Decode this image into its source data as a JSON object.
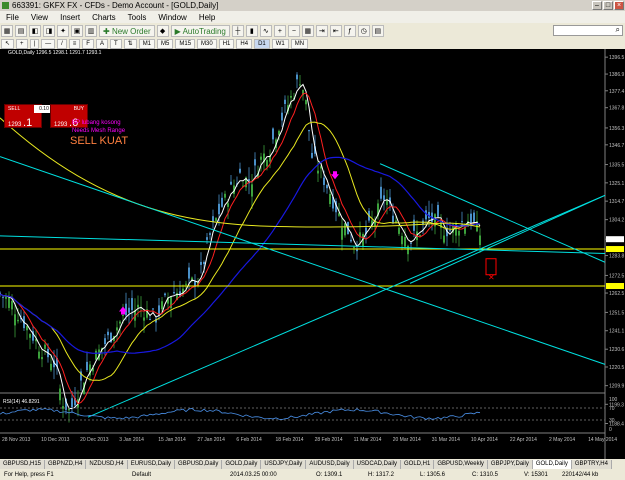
{
  "window": {
    "title": "663391: GKFX FX - CFDs - Demo Account - [GOLD,Daily]",
    "controls": [
      "–",
      "□",
      "×"
    ]
  },
  "menu": [
    "File",
    "View",
    "Insert",
    "Charts",
    "Tools",
    "Window",
    "Help"
  ],
  "toolbar": {
    "new_order": "New Order",
    "autotrading": "AutoTrading",
    "search_placeholder": ""
  },
  "timeframes": [
    "M1",
    "M5",
    "M15",
    "M30",
    "H1",
    "H4",
    "D1",
    "W1",
    "MN"
  ],
  "trade_panel": {
    "sell_label": "SELL",
    "buy_label": "BUY",
    "lot": "0.10",
    "sell_price_small": "1293",
    "sell_price_big": ".1",
    "buy_price_small": "1293",
    "buy_price_big": ".6"
  },
  "chart": {
    "symbol_info": "GOLD,Daily  1296.5 1298.1 1291.7 1293.1",
    "annotations": {
      "line1": "BP lubang kosong",
      "line2": "Needs Mesh Range",
      "signal": "SELL KUAT",
      "signal_colors": [
        "#ff00ff",
        "#ff00ff",
        "#ff8040"
      ]
    },
    "price_labels": [
      "1396.5",
      "1386.9",
      "1377.4",
      "1367.8",
      "1356.3",
      "1346.7",
      "1335.5",
      "1325.1",
      "1314.7",
      "1304.2",
      "1293.1",
      "1283.8",
      "1272.5",
      "1262.5",
      "1251.5",
      "1241.1",
      "1230.6",
      "1220.5",
      "1209.9",
      "1199.3",
      "1188.4"
    ],
    "price_range": [
      1183,
      1400
    ],
    "current_price": "1293.1",
    "tag_prices": [
      "1287.5",
      "1266.5"
    ],
    "date_labels": [
      "28 Nov 2013",
      "10 Dec 2013",
      "20 Dec 2013",
      "3 Jan 2014",
      "15 Jan 2014",
      "27 Jan 2014",
      "6 Feb 2014",
      "18 Feb 2014",
      "28 Feb 2014",
      "11 Mar 2014",
      "20 Mar 2014",
      "31 Mar 2014",
      "10 Apr 2014",
      "22 Apr 2014",
      "2 May 2014",
      "14 May 2014"
    ],
    "rsi_label": "RSI(14) 46.8291",
    "rsi_levels": [
      "100",
      "70",
      "30",
      "0"
    ],
    "colors": {
      "bull": "#3ca03c",
      "bear": "#4a90c8",
      "ma_white": "#ffffff",
      "ma_red": "#ff2020",
      "ma_yellow": "#e8e820",
      "ma_blue": "#1818e0",
      "trend": "#00e0e0",
      "hline": "#ffff00"
    }
  },
  "tabs": [
    "GBPUSD,H15",
    "GBPNZD,H4",
    "NZDUSD,H4",
    "EURUSD,Daily",
    "GBPUSD,Daily",
    "GOLD,Daily",
    "USDJPY,Daily",
    "AUDUSD,Daily",
    "USDCAD,Daily",
    "GOLD,H1",
    "GBPUSD,Weekly",
    "GBPJPY,Daily",
    "GOLD,Daily",
    "GBPTRY,H4"
  ],
  "active_tab": 12,
  "status": {
    "help": "For Help, press F1",
    "profile": "Default",
    "time": "2014.03.25 00:00",
    "open": "O: 1309.1",
    "high": "H: 1317.2",
    "low": "L: 1305.6",
    "close": "C: 1310.5",
    "volume": "V: 15301",
    "traffic": "220142/44 kb"
  }
}
